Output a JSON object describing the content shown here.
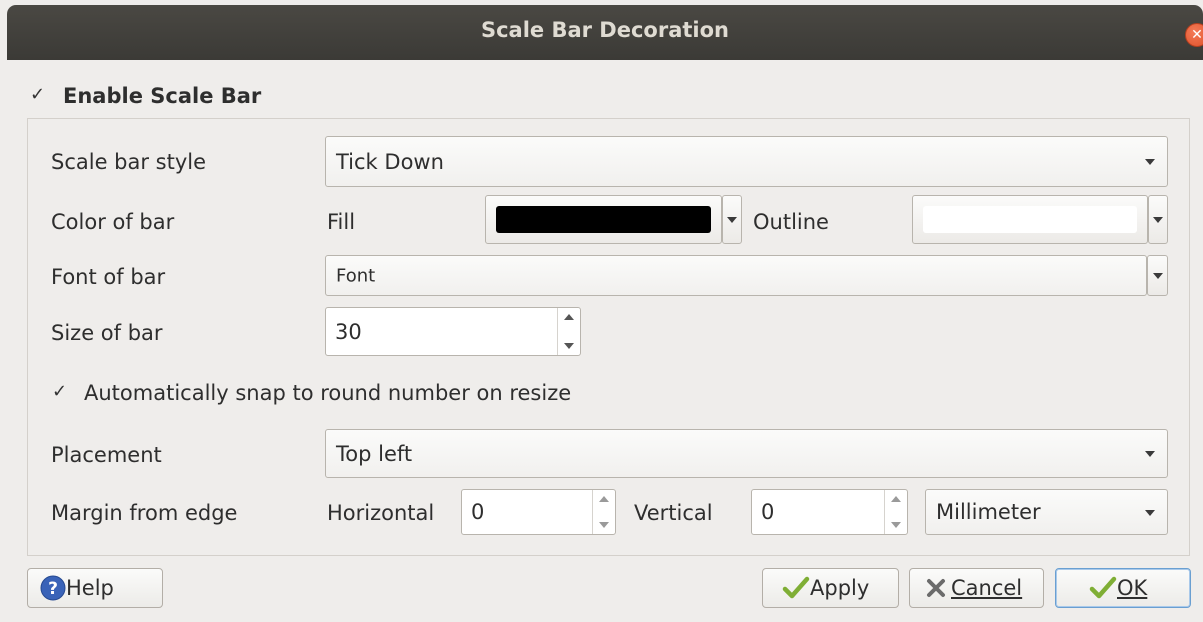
{
  "window": {
    "title": "Scale Bar Decoration"
  },
  "enable": {
    "label": "Enable Scale Bar",
    "checked": true
  },
  "style": {
    "label": "Scale bar style",
    "value": "Tick Down"
  },
  "color": {
    "label": "Color of bar",
    "fill_label": "Fill",
    "fill_color": "#000000",
    "outline_label": "Outline",
    "outline_color": "#ffffff"
  },
  "font": {
    "label": "Font of bar",
    "value": "Font"
  },
  "size": {
    "label": "Size of bar",
    "value": "30"
  },
  "snap": {
    "label": "Automatically snap to round number on resize",
    "checked": true
  },
  "placement": {
    "label": "Placement",
    "value": "Top left"
  },
  "margin": {
    "label": "Margin from edge",
    "horizontal_label": "Horizontal",
    "horizontal_value": "0",
    "vertical_label": "Vertical",
    "vertical_value": "0",
    "unit": "Millimeter"
  },
  "buttons": {
    "help": "Help",
    "apply": "Apply",
    "cancel": "Cancel",
    "ok": "OK"
  },
  "icons": {
    "close": "close-icon",
    "help": "help-icon",
    "apply": "check-icon",
    "cancel": "x-icon",
    "ok": "check-icon"
  }
}
